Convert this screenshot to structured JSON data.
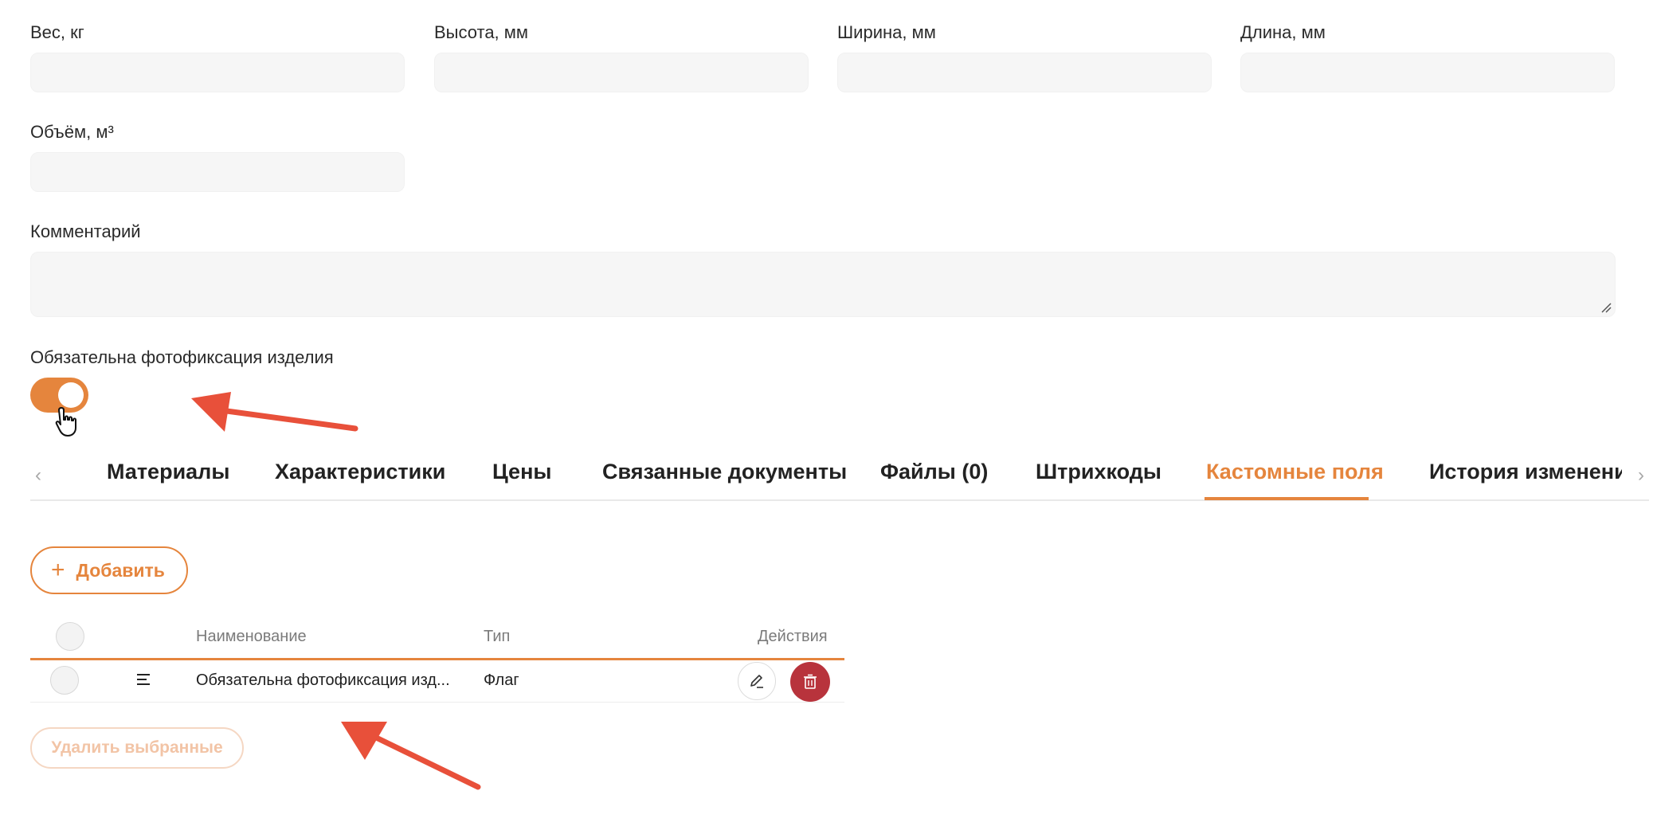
{
  "fields": {
    "weight": {
      "label": "Вес, кг",
      "value": ""
    },
    "height": {
      "label": "Высота, мм",
      "value": ""
    },
    "width": {
      "label": "Ширина, мм",
      "value": ""
    },
    "length": {
      "label": "Длина, мм",
      "value": ""
    },
    "volume": {
      "label": "Объём, м³",
      "value": ""
    },
    "comment": {
      "label": "Комментарий",
      "value": ""
    }
  },
  "photo_toggle": {
    "label": "Обязательна фотофиксация изделия",
    "on": true
  },
  "tabs": [
    {
      "label": "Материалы"
    },
    {
      "label": "Характеристики"
    },
    {
      "label": "Цены"
    },
    {
      "label": "Связанные документы"
    },
    {
      "label": "Файлы (0)"
    },
    {
      "label": "Штрихкоды"
    },
    {
      "label": "Кастомные поля",
      "active": true
    },
    {
      "label": "История изменений"
    }
  ],
  "add_button": {
    "label": "Добавить"
  },
  "table": {
    "columns": {
      "name": "Наименование",
      "type": "Тип",
      "actions": "Действия"
    },
    "rows": [
      {
        "name": "Обязательна фотофиксация изд...",
        "type": "Флаг"
      }
    ]
  },
  "bulk_delete": {
    "label": "Удалить выбранные"
  },
  "colors": {
    "accent": "#e5853d",
    "danger": "#b8333c",
    "annotation": "#e8503a"
  }
}
